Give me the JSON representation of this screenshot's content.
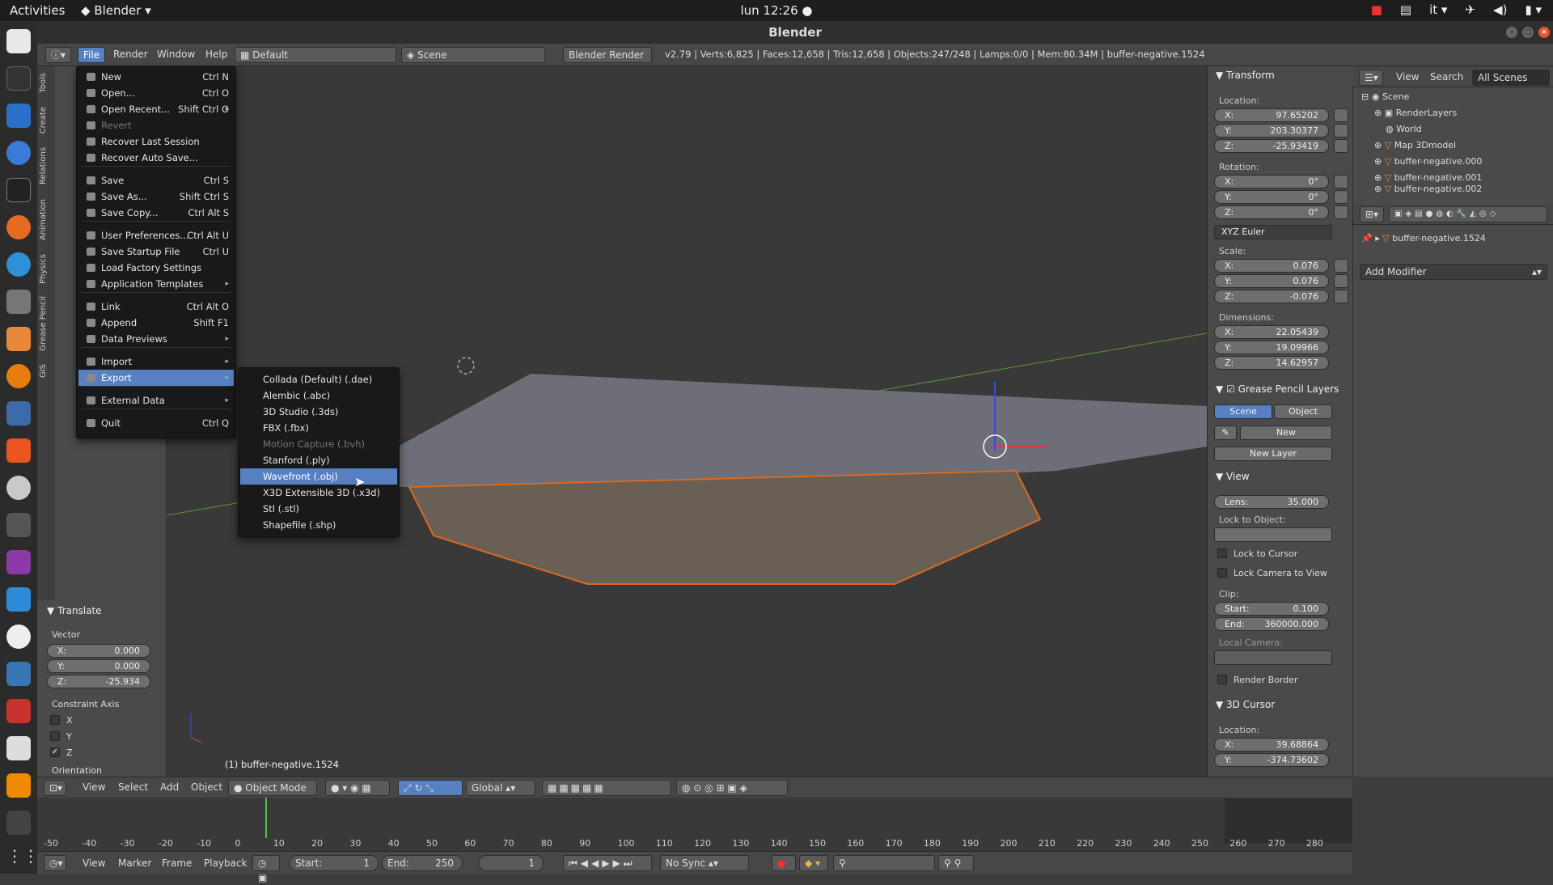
{
  "topbar": {
    "activities": "Activities",
    "app": "Blender",
    "clock": "lun 12:26 ●",
    "lang": "it"
  },
  "window": {
    "title": "Blender"
  },
  "info_header": {
    "menus": [
      "File",
      "Render",
      "Window",
      "Help"
    ],
    "layout": "Default",
    "scene": "Scene",
    "engine": "Blender Render",
    "stats": "v2.79 | Verts:6,825 | Faces:12,658 | Tris:12,658 | Objects:247/248 | Lamps:0/0 | Mem:80.34M | buffer-negative.1524"
  },
  "file_menu": [
    {
      "label": "New",
      "shortcut": "Ctrl N"
    },
    {
      "label": "Open...",
      "shortcut": "Ctrl O"
    },
    {
      "label": "Open Recent...",
      "shortcut": "Shift Ctrl O"
    },
    {
      "label": "Revert",
      "shortcut": ""
    },
    {
      "label": "Recover Last Session",
      "shortcut": ""
    },
    {
      "label": "Recover Auto Save...",
      "shortcut": ""
    },
    {
      "label": "Save",
      "shortcut": "Ctrl S"
    },
    {
      "label": "Save As...",
      "shortcut": "Shift Ctrl S"
    },
    {
      "label": "Save Copy...",
      "shortcut": "Ctrl Alt S"
    },
    {
      "label": "User Preferences...",
      "shortcut": "Ctrl Alt U"
    },
    {
      "label": "Save Startup File",
      "shortcut": "Ctrl U"
    },
    {
      "label": "Load Factory Settings",
      "shortcut": ""
    },
    {
      "label": "Application Templates",
      "shortcut": ""
    },
    {
      "label": "Link",
      "shortcut": "Ctrl Alt O"
    },
    {
      "label": "Append",
      "shortcut": "Shift F1"
    },
    {
      "label": "Data Previews",
      "shortcut": ""
    },
    {
      "label": "Import",
      "shortcut": ""
    },
    {
      "label": "Export",
      "shortcut": ""
    },
    {
      "label": "External Data",
      "shortcut": ""
    },
    {
      "label": "Quit",
      "shortcut": "Ctrl Q"
    }
  ],
  "export_menu": [
    "Collada (Default) (.dae)",
    "Alembic (.abc)",
    "3D Studio (.3ds)",
    "FBX (.fbx)",
    "Motion Capture (.bvh)",
    "Stanford (.ply)",
    "Wavefront (.obj)",
    "X3D Extensible 3D (.x3d)",
    "Stl (.stl)",
    "Shapefile (.shp)"
  ],
  "tool_tabs": [
    "Tools",
    "Create",
    "Relations",
    "Animation",
    "Physics",
    "Grease Pencil",
    "GIS"
  ],
  "translate_panel": {
    "title": "Translate",
    "vector": "Vector",
    "x": "0.000",
    "y": "0.000",
    "z": "-25.934",
    "constraint": "Constraint Axis",
    "ax": "X",
    "ay": "Y",
    "az": "Z",
    "orientation": "Orientation"
  },
  "viewport": {
    "object_label": "(1) buffer-negative.1524"
  },
  "transform": {
    "title": "Transform",
    "location": "Location:",
    "loc": [
      "97.65202",
      "203.30377",
      "-25.93419"
    ],
    "rotation": "Rotation:",
    "rot": [
      "0°",
      "0°",
      "0°"
    ],
    "euler": "XYZ Euler",
    "scale": "Scale:",
    "sca": [
      "0.076",
      "0.076",
      "-0.076"
    ],
    "dimensions": "Dimensions:",
    "dim": [
      "22.05439",
      "19.09966",
      "14.62957"
    ]
  },
  "grease": {
    "title": "Grease Pencil Layers",
    "scene": "Scene",
    "object": "Object",
    "new": "New",
    "new_layer": "New Layer"
  },
  "view": {
    "title": "View",
    "lens_k": "Lens:",
    "lens_v": "35.000",
    "lock_obj": "Lock to Object:",
    "lock_cursor": "Lock to Cursor",
    "lock_cam": "Lock Camera to View",
    "clip": "Clip:",
    "start_k": "Start:",
    "start_v": "0.100",
    "end_k": "End:",
    "end_v": "360000.000",
    "local_cam": "Local Camera:",
    "render_border": "Render Border"
  },
  "cursor3d": {
    "title": "3D Cursor",
    "location": "Location:",
    "x": "39.68864",
    "y": "-374.73602"
  },
  "outliner": {
    "view": "View",
    "search": "Search",
    "all": "All Scenes",
    "rows": [
      "Scene",
      "RenderLayers",
      "World",
      "Map 3Dmodel",
      "buffer-negative.000",
      "buffer-negative.001",
      "buffer-negative.002"
    ]
  },
  "properties": {
    "object": "buffer-negative.1524",
    "add_modifier": "Add Modifier"
  },
  "view_header": {
    "view": "View",
    "select": "Select",
    "add": "Add",
    "object": "Object",
    "mode": "Object Mode",
    "orient": "Global"
  },
  "timeline": {
    "ticks": [
      "-50",
      "-40",
      "-30",
      "-20",
      "-10",
      "0",
      "10",
      "20",
      "30",
      "40",
      "50",
      "60",
      "70",
      "80",
      "90",
      "100",
      "110",
      "120",
      "130",
      "140",
      "150",
      "160",
      "170",
      "180",
      "190",
      "200",
      "210",
      "220",
      "230",
      "240",
      "250",
      "260",
      "270",
      "280"
    ],
    "view": "View",
    "marker": "Marker",
    "frame": "Frame",
    "playback": "Playback",
    "start_k": "Start:",
    "start_v": "1",
    "end_k": "End:",
    "end_v": "250",
    "current": "1",
    "sync": "No Sync"
  }
}
